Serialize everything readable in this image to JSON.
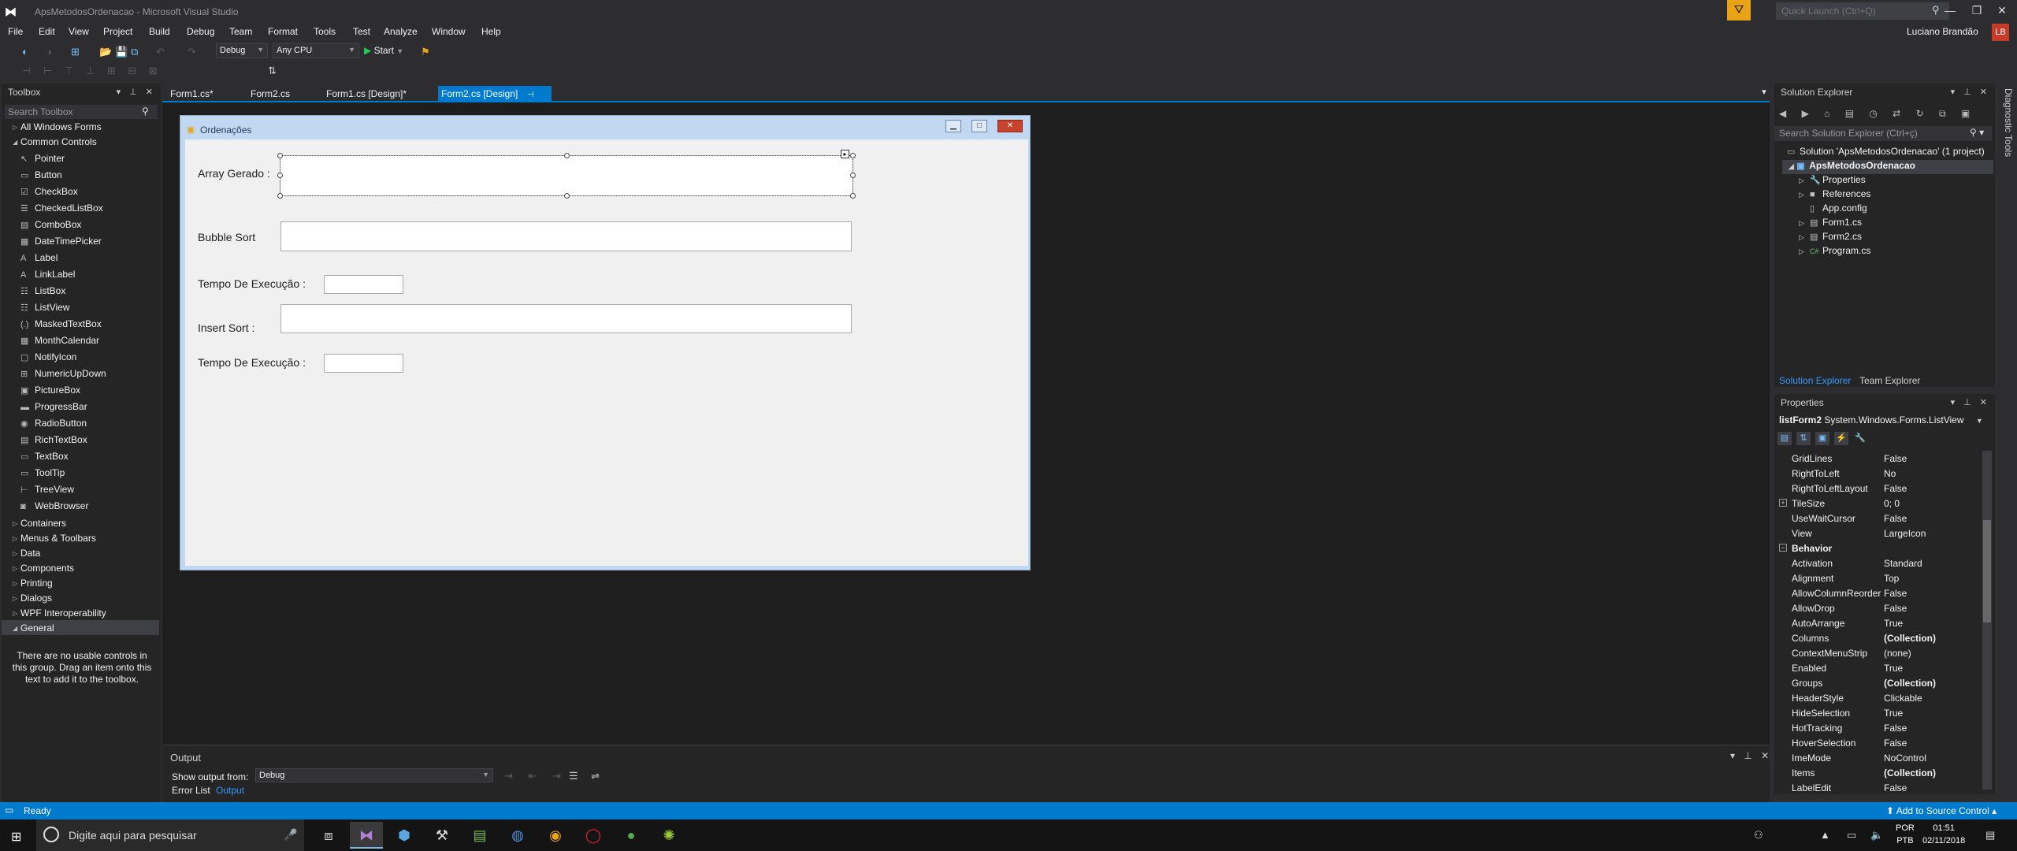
{
  "window": {
    "title": "ApsMetodosOrdenacao - Microsoft Visual Studio",
    "quick_launch_placeholder": "Quick Launch (Ctrl+Q)",
    "user": "Luciano Brandão",
    "user_initials": "LB"
  },
  "menu": [
    "File",
    "Edit",
    "View",
    "Project",
    "Build",
    "Debug",
    "Team",
    "Format",
    "Tools",
    "Test",
    "Analyze",
    "Window",
    "Help"
  ],
  "toolbar": {
    "config": "Debug",
    "platform": "Any CPU",
    "start": "Start"
  },
  "toolbox": {
    "title": "Toolbox",
    "search_placeholder": "Search Toolbox",
    "groups_top": [
      "All Windows Forms",
      "Common Controls"
    ],
    "common_controls": [
      {
        "icon": "pointer-icon",
        "glyph": "↖",
        "label": "Pointer"
      },
      {
        "icon": "button-icon",
        "glyph": "▭",
        "label": "Button"
      },
      {
        "icon": "checkbox-icon",
        "glyph": "☑",
        "label": "CheckBox"
      },
      {
        "icon": "checkedlistbox-icon",
        "glyph": "☰",
        "label": "CheckedListBox"
      },
      {
        "icon": "combobox-icon",
        "glyph": "▤",
        "label": "ComboBox"
      },
      {
        "icon": "datetimepicker-icon",
        "glyph": "▦",
        "label": "DateTimePicker"
      },
      {
        "icon": "label-icon",
        "glyph": "A",
        "label": "Label"
      },
      {
        "icon": "linklabel-icon",
        "glyph": "A",
        "label": "LinkLabel"
      },
      {
        "icon": "listbox-icon",
        "glyph": "☷",
        "label": "ListBox"
      },
      {
        "icon": "listview-icon",
        "glyph": "☷",
        "label": "ListView"
      },
      {
        "icon": "maskedtextbox-icon",
        "glyph": "(.)",
        "label": "MaskedTextBox"
      },
      {
        "icon": "monthcalendar-icon",
        "glyph": "▦",
        "label": "MonthCalendar"
      },
      {
        "icon": "notifyicon-icon",
        "glyph": "▢",
        "label": "NotifyIcon"
      },
      {
        "icon": "numericupdown-icon",
        "glyph": "⊞",
        "label": "NumericUpDown"
      },
      {
        "icon": "picturebox-icon",
        "glyph": "▣",
        "label": "PictureBox"
      },
      {
        "icon": "progressbar-icon",
        "glyph": "▬",
        "label": "ProgressBar"
      },
      {
        "icon": "radiobutton-icon",
        "glyph": "◉",
        "label": "RadioButton"
      },
      {
        "icon": "richtextbox-icon",
        "glyph": "▤",
        "label": "RichTextBox"
      },
      {
        "icon": "textbox-icon",
        "glyph": "▭",
        "label": "TextBox"
      },
      {
        "icon": "tooltip-icon",
        "glyph": "▭",
        "label": "ToolTip"
      },
      {
        "icon": "treeview-icon",
        "glyph": "⊢",
        "label": "TreeView"
      },
      {
        "icon": "webbrowser-icon",
        "glyph": "◙",
        "label": "WebBrowser"
      }
    ],
    "groups_bottom": [
      "Containers",
      "Menus & Toolbars",
      "Data",
      "Components",
      "Printing",
      "Dialogs",
      "WPF Interoperability",
      "General"
    ],
    "hint": "There are no usable controls in this group. Drag an item onto this text to add it to the toolbox."
  },
  "tabs": [
    {
      "label": "Form1.cs*"
    },
    {
      "label": "Form2.cs"
    },
    {
      "label": "Form1.cs [Design]*"
    },
    {
      "label": "Form2.cs [Design]"
    }
  ],
  "form": {
    "title": "Ordenações",
    "labels": {
      "array": "Array Gerado :",
      "bubble": "Bubble Sort",
      "tempo1": "Tempo De Execução :",
      "insert": "Insert Sort :",
      "tempo2": "Tempo De Execução :"
    }
  },
  "output": {
    "title": "Output",
    "show_from": "Show output from:",
    "source": "Debug",
    "tab_error": "Error List",
    "tab_output": "Output"
  },
  "diag": "Diagnostic Tools",
  "solution_explorer": {
    "title": "Solution Explorer",
    "search_placeholder": "Search Solution Explorer (Ctrl+ç)",
    "solution": "Solution 'ApsMetodosOrdenacao' (1 project)",
    "project": "ApsMetodosOrdenacao",
    "items": [
      {
        "icon": "wrench-icon",
        "glyph": "🔧",
        "label": "Properties",
        "expand": true
      },
      {
        "icon": "references-icon",
        "glyph": "■",
        "label": "References",
        "expand": true
      },
      {
        "icon": "config-icon",
        "glyph": "▯",
        "label": "App.config",
        "expand": false
      },
      {
        "icon": "form-icon",
        "glyph": "▤",
        "label": "Form1.cs",
        "expand": true
      },
      {
        "icon": "form-icon",
        "glyph": "▤",
        "label": "Form2.cs",
        "expand": true
      },
      {
        "icon": "csharp-icon",
        "glyph": "C#",
        "label": "Program.cs",
        "expand": true
      }
    ],
    "tab_se": "Solution Explorer",
    "tab_team": "Team Explorer"
  },
  "properties": {
    "title": "Properties",
    "object_name": "listForm2",
    "object_type": "System.Windows.Forms.ListView",
    "rows": [
      {
        "name": "GridLines",
        "value": "False"
      },
      {
        "name": "RightToLeft",
        "value": "No"
      },
      {
        "name": "RightToLeftLayout",
        "value": "False"
      },
      {
        "name": "TileSize",
        "value": "0; 0",
        "expand": "+"
      },
      {
        "name": "UseWaitCursor",
        "value": "False"
      },
      {
        "name": "View",
        "value": "LargeIcon"
      },
      {
        "name": "Behavior",
        "value": "",
        "category": true
      },
      {
        "name": "Activation",
        "value": "Standard"
      },
      {
        "name": "Alignment",
        "value": "Top"
      },
      {
        "name": "AllowColumnReorder",
        "value": "False"
      },
      {
        "name": "AllowDrop",
        "value": "False"
      },
      {
        "name": "AutoArrange",
        "value": "True"
      },
      {
        "name": "Columns",
        "value": "(Collection)",
        "bold": true
      },
      {
        "name": "ContextMenuStrip",
        "value": "(none)"
      },
      {
        "name": "Enabled",
        "value": "True"
      },
      {
        "name": "Groups",
        "value": "(Collection)",
        "bold": true
      },
      {
        "name": "HeaderStyle",
        "value": "Clickable"
      },
      {
        "name": "HideSelection",
        "value": "True"
      },
      {
        "name": "HotTracking",
        "value": "False"
      },
      {
        "name": "HoverSelection",
        "value": "False"
      },
      {
        "name": "ImeMode",
        "value": "NoControl"
      },
      {
        "name": "Items",
        "value": "(Collection)",
        "bold": true
      },
      {
        "name": "LabelEdit",
        "value": "False"
      }
    ]
  },
  "status": {
    "ready": "Ready",
    "source_control": "Add to Source Control"
  },
  "taskbar": {
    "search": "Digite aqui para pesquisar",
    "lang1": "POR",
    "lang2": "PTB",
    "time": "01:51",
    "date": "02/11/2018"
  }
}
